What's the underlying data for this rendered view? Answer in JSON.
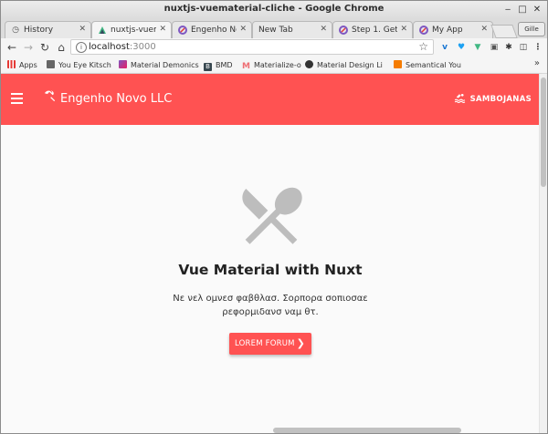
{
  "window": {
    "title": "nuxtjs-vuematerial-cliche - Google Chrome"
  },
  "tabs": [
    {
      "label": "History",
      "icon": "history-icon"
    },
    {
      "label": "nuxtjs-vuematerial",
      "icon": "nuxt-icon"
    },
    {
      "label": "Engenho Novo",
      "icon": "webpack-icon"
    },
    {
      "label": "New Tab",
      "icon": ""
    },
    {
      "label": "Step 1. Get",
      "icon": "webpack-icon"
    },
    {
      "label": "My App",
      "icon": "webpack-icon"
    }
  ],
  "profile_label": "Gille",
  "omnibox": {
    "host": "localhost",
    "port": ":3000"
  },
  "bookmarks": [
    {
      "label": "Apps",
      "icon": "apps-grid-icon",
      "color": "#e53935"
    },
    {
      "label": "You Eye Kitsch",
      "icon": "bookmark-icon",
      "color": "#555555"
    },
    {
      "label": "Material Demonics",
      "icon": "material-icon",
      "color": "#7e57c2"
    },
    {
      "label": "BMD",
      "icon": "b-icon",
      "color": "#37474f"
    },
    {
      "label": "Materialize-o",
      "icon": "m-icon",
      "color": "#ee6e73"
    },
    {
      "label": "Material Design Li",
      "icon": "github-icon",
      "color": "#333333"
    },
    {
      "label": "Semantical You",
      "icon": "semantic-icon",
      "color": "#f57c00"
    }
  ],
  "app": {
    "brand": "Engenho Novo LLC",
    "right_button": "SAMBOJANAS",
    "heading": "Vue Material with Nuxt",
    "text_line1": "Νε νελ ομνεσ φαβθλασ. Σορπορα σοπιοσαε",
    "text_line2": "ρεφορμιδανσ ναμ θτ.",
    "cta_label": "LOREM FORUM"
  },
  "colors": {
    "accent": "#ff5252",
    "background": "#fafafa",
    "icon_gray": "#bdbdbd"
  }
}
